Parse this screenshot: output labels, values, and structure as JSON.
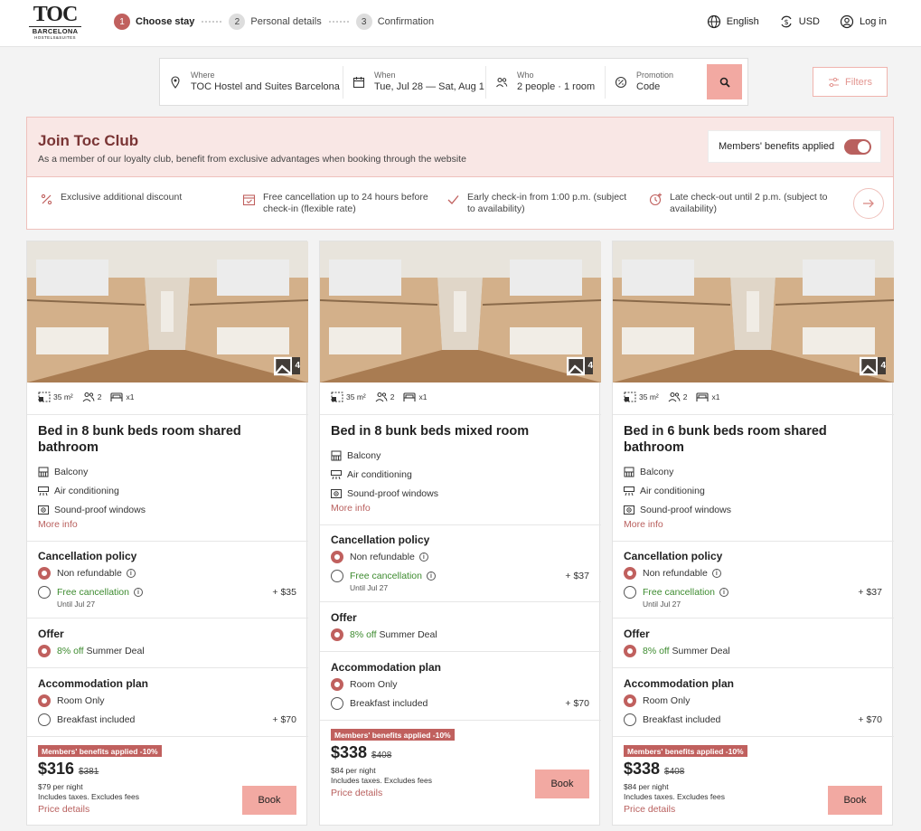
{
  "logo": {
    "main": "TOC",
    "city": "BARCELONA",
    "tagline": "HOSTELS&SUITES"
  },
  "steps": [
    {
      "num": "1",
      "label": "Choose stay"
    },
    {
      "num": "2",
      "label": "Personal details"
    },
    {
      "num": "3",
      "label": "Confirmation"
    }
  ],
  "topright": {
    "language": "English",
    "currency": "USD",
    "login": "Log in"
  },
  "search": {
    "where_label": "Where",
    "where_value": "TOC Hostel and Suites Barcelona",
    "when_label": "When",
    "when_value": "Tue, Jul 28 — Sat, Aug 1",
    "who_label": "Who",
    "who_value": "2 people · 1 room",
    "promo_label": "Promotion",
    "promo_value": "Code"
  },
  "filters_label": "Filters",
  "club": {
    "title": "Join Toc Club",
    "subtitle": "As a member of our loyalty club, benefit from exclusive advantages when booking through the website",
    "members_label": "Members' benefits applied",
    "benefits": [
      "Exclusive additional discount",
      "Free cancellation up to 24 hours before check-in (flexible rate)",
      "Early check-in from 1:00 p.m. (subject to availability)",
      "Late check-out until 2 p.m. (subject to availability)"
    ]
  },
  "labels": {
    "more_info": "More info",
    "cancellation_policy": "Cancellation policy",
    "non_refundable": "Non refundable",
    "free_cancellation": "Free cancellation",
    "until": "Until Jul 27",
    "offer": "Offer",
    "offer_pct": "8% off",
    "offer_name": "Summer Deal",
    "accommodation_plan": "Accommodation plan",
    "room_only": "Room Only",
    "breakfast": "Breakfast included",
    "member_badge": "Members' benefits applied -10%",
    "taxes": "Includes taxes. Excludes fees",
    "price_details": "Price details",
    "book": "Book",
    "photo_count": "4",
    "area": "35 m²",
    "guests": "2",
    "beds": "x1",
    "amenity_balcony": "Balcony",
    "amenity_ac": "Air conditioning",
    "amenity_sound": "Sound-proof windows"
  },
  "rooms": [
    {
      "name": "Bed in 8 bunk beds room shared bathroom",
      "free_cancel_add": "+ $35",
      "breakfast_add": "+ $70",
      "price": "$316",
      "old_price": "$381",
      "per_night": "$79 per night"
    },
    {
      "name": "Bed in 8 bunk beds mixed room",
      "free_cancel_add": "+ $37",
      "breakfast_add": "+ $70",
      "price": "$338",
      "old_price": "$408",
      "per_night": "$84 per night"
    },
    {
      "name": "Bed in 6 bunk beds room shared bathroom",
      "free_cancel_add": "+ $37",
      "breakfast_add": "+ $70",
      "price": "$338",
      "old_price": "$408",
      "per_night": "$84 per night"
    }
  ]
}
